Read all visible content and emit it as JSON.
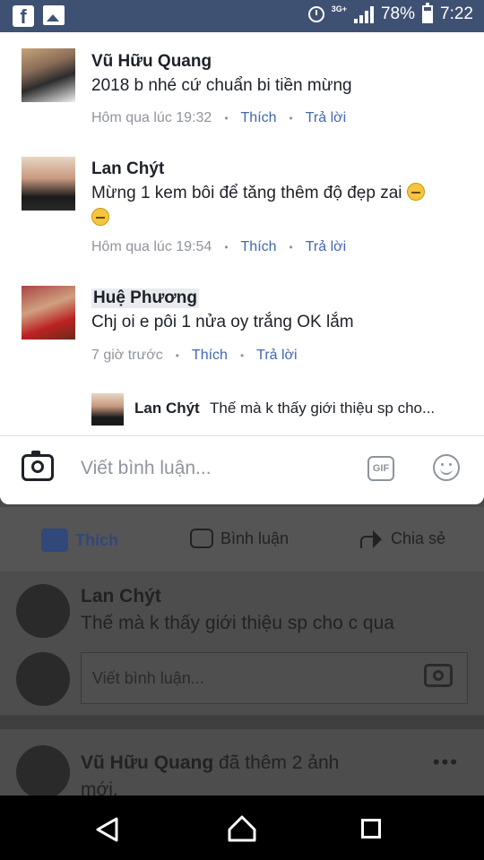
{
  "status_bar": {
    "battery": "78%",
    "time": "7:22",
    "network": "3G+",
    "icons": [
      "facebook-icon",
      "gallery-icon",
      "alarm-icon",
      "signal-icon",
      "battery-icon"
    ]
  },
  "comments": [
    {
      "name": "Vũ Hữu Quang",
      "text": "2018 b nhé cứ chuẩn bi tiền mừng",
      "time": "Hôm qua lúc 19:32",
      "like": "Thích",
      "reply": "Trả lời"
    },
    {
      "name": "Lan Chýt",
      "text": "Mừng 1 kem bôi để tăng thêm độ đẹp zai",
      "time": "Hôm qua lúc 19:54",
      "like": "Thích",
      "reply": "Trả lời"
    },
    {
      "name": "Huệ Phương",
      "text": "Chj  oi  e pôi 1 nửa  oy  trắng  OK lắm",
      "time": "7 giờ trước",
      "like": "Thích",
      "reply": "Trả lời"
    }
  ],
  "reply_preview": {
    "name": "Lan Chýt",
    "text": "Thế mà k thấy giới thiệu sp cho..."
  },
  "input": {
    "placeholder": "Viết bình luận...",
    "gif_label": "GIF"
  },
  "background_post": {
    "actions": [
      "Thích",
      "Bình luận",
      "Chia sẻ"
    ],
    "comment_name": "Lan Chýt",
    "comment_text": "Thế mà k thấy giới thiệu sp cho c qua",
    "input_placeholder": "Viết bình luận...",
    "next_post_name": "Vũ Hữu Quang",
    "next_post_action": "đã thêm 2 ảnh",
    "next_post_action_line2": "mới.",
    "more": "•••"
  },
  "colors": {
    "status_bar": "#3f5173",
    "link": "#4267b2",
    "meta": "#90949c",
    "text": "#1d2129"
  }
}
